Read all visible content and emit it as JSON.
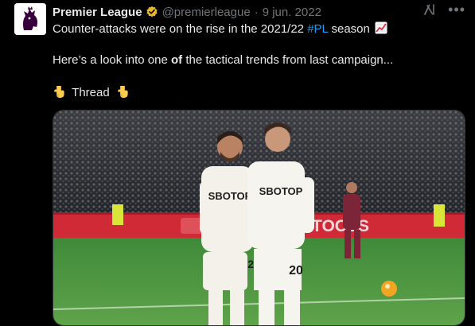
{
  "tweet": {
    "author_name": "Premier League",
    "handle": "@premierleague",
    "separator": "·",
    "date": "9 jun. 2022",
    "line1_text": "Counter-attacks were on the rise in the 2021/22 ",
    "line1_hashtag": "#PL",
    "line1_after": " season",
    "line2_before": "Here’s a look into one ",
    "line2_bold": "of",
    "line2_after": " the tactical trends from last campaign...",
    "thread_label": "Thread",
    "more_label": "•••"
  },
  "photo": {
    "shirt_sponsor": "SBOTOP",
    "shirt_numbers": [
      "22",
      "20"
    ],
    "board_text": "TOOLS"
  },
  "colors": {
    "background": "#000000",
    "text": "#e7e9ea",
    "muted": "#71767b",
    "link": "#1d9bf0",
    "pl_purple": "#38003c"
  },
  "icons": [
    "pl-lion-logo-icon",
    "verified-badge-icon",
    "grok-icon",
    "more-icon",
    "chart-increasing-icon",
    "pointing-down-icon"
  ]
}
